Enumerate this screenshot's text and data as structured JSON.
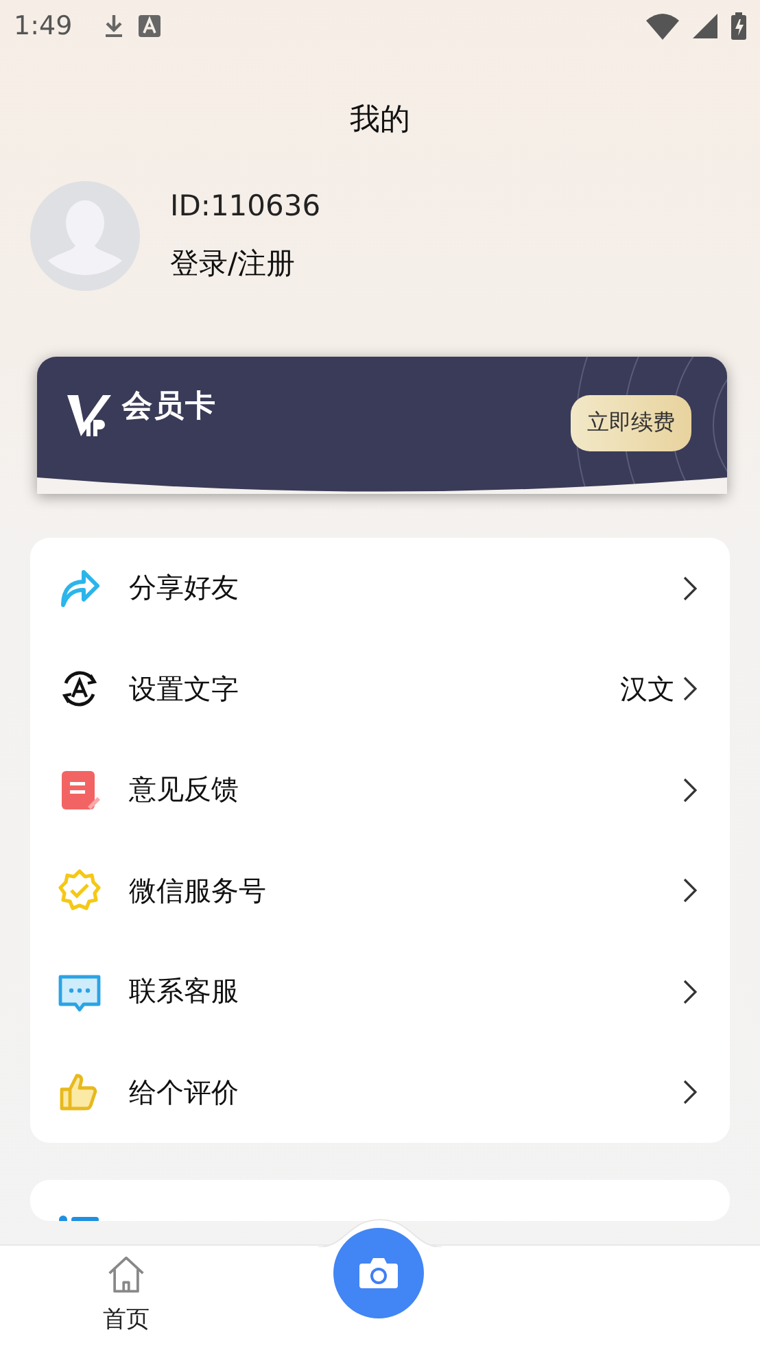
{
  "status_bar": {
    "time": "1:49"
  },
  "header": {
    "title": "我的"
  },
  "profile": {
    "id": "ID:110636",
    "login": "登录/注册"
  },
  "vip_card": {
    "title": "会员卡",
    "button": "立即续费"
  },
  "menu": [
    {
      "label": "分享好友"
    },
    {
      "label": "设置文字",
      "value": "汉文"
    },
    {
      "label": "意见反馈"
    },
    {
      "label": "微信服务号"
    },
    {
      "label": "联系客服"
    },
    {
      "label": "给个评价"
    }
  ],
  "tab_bar": {
    "tabs": [
      {
        "label": "首页",
        "selected": false
      }
    ]
  }
}
